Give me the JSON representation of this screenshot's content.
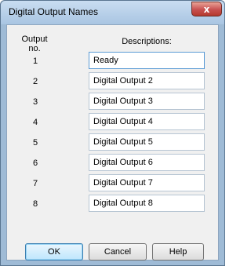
{
  "window": {
    "title": "Digital Output Names",
    "close_glyph": "x"
  },
  "columns": {
    "output_no": "Output\nno.",
    "descriptions": "Descriptions:"
  },
  "rows": [
    {
      "num": "1",
      "value": "Ready"
    },
    {
      "num": "2",
      "value": "Digital Output 2"
    },
    {
      "num": "3",
      "value": "Digital Output 3"
    },
    {
      "num": "4",
      "value": "Digital Output 4"
    },
    {
      "num": "5",
      "value": "Digital Output 5"
    },
    {
      "num": "6",
      "value": "Digital Output 6"
    },
    {
      "num": "7",
      "value": "Digital Output 7"
    },
    {
      "num": "8",
      "value": "Digital Output 8"
    }
  ],
  "buttons": {
    "ok": "OK",
    "cancel": "Cancel",
    "help": "Help"
  }
}
